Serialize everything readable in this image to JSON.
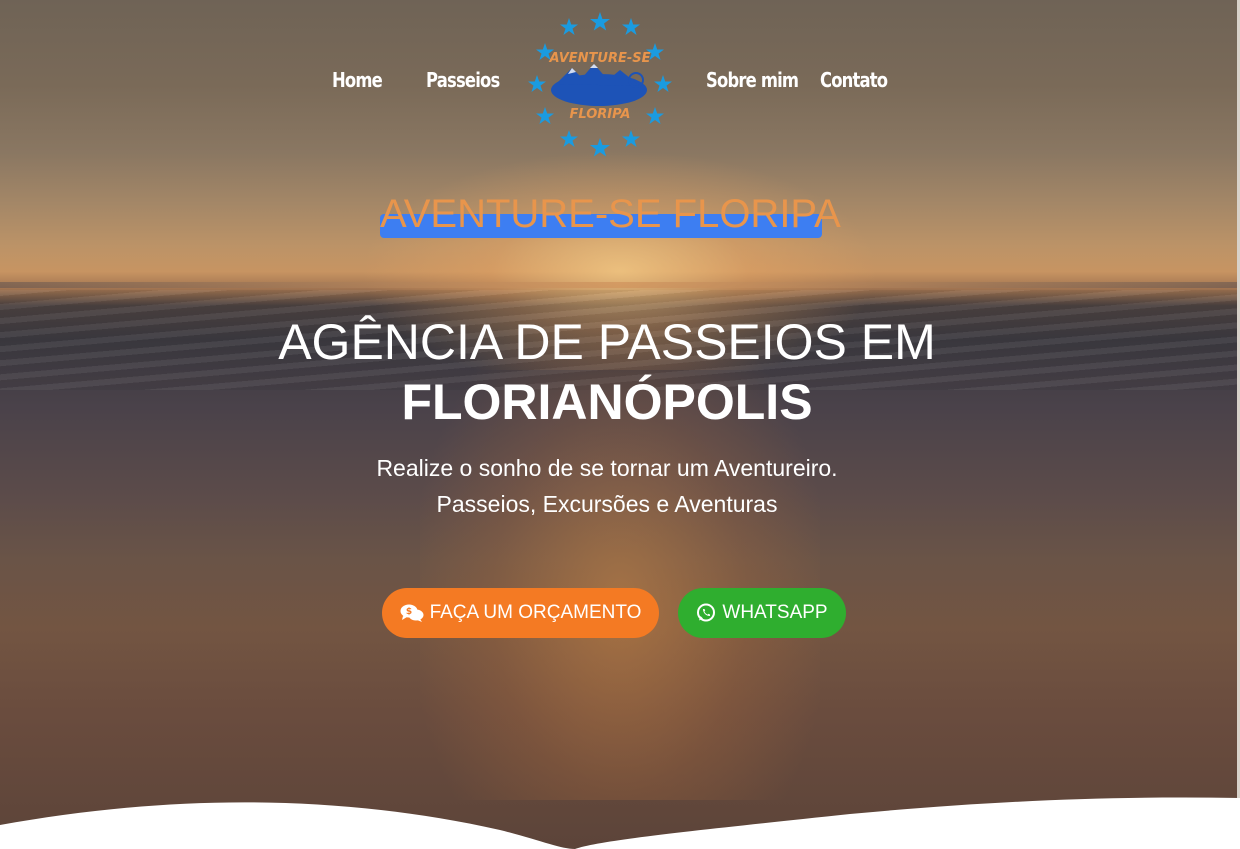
{
  "nav": {
    "items": [
      {
        "label": "Home"
      },
      {
        "label": "Passeios"
      },
      {
        "label": "Sobre mim"
      },
      {
        "label": "Contato"
      }
    ],
    "logo": {
      "top_text": "AVENTURE-SE",
      "bottom_text": "FLORIPA",
      "star_color": "#1a9be0",
      "text_color": "#e8954c",
      "emblem_color": "#1d53b7"
    }
  },
  "hero": {
    "brand": "AVENTURE-SE FLORIPA",
    "headline_line1": "AGÊNCIA DE PASSEIOS EM",
    "headline_line2": "FLORIANÓPOLIS",
    "subtitle_line1": "Realize o sonho de se tornar um Aventureiro.",
    "subtitle_line2": "Passeios, Excursões e Aventuras",
    "buttons": {
      "quote": {
        "label": "FAÇA UM ORÇAMENTO",
        "icon": "comments-dollar-icon",
        "color": "#f47a23"
      },
      "whatsapp": {
        "label": "WHATSAPP",
        "icon": "whatsapp-icon",
        "color": "#2fae2f"
      }
    }
  },
  "colors": {
    "brand_highlight": "#3d7ef2",
    "brand_text": "#e8954c"
  }
}
